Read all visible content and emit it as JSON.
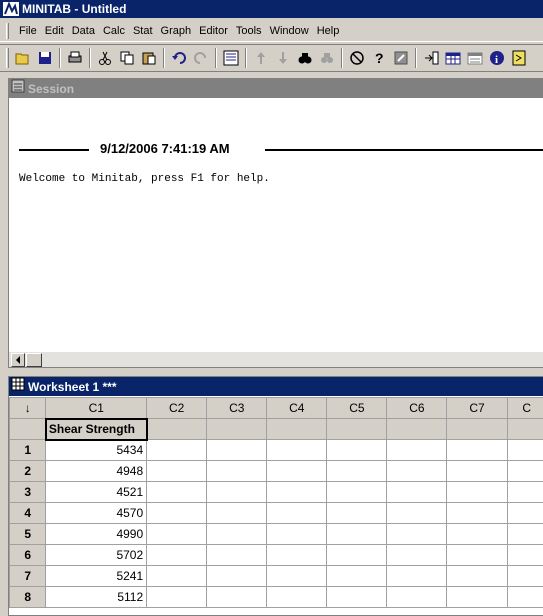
{
  "window": {
    "title": "MINITAB - Untitled"
  },
  "menu": [
    "File",
    "Edit",
    "Data",
    "Calc",
    "Stat",
    "Graph",
    "Editor",
    "Tools",
    "Window",
    "Help"
  ],
  "toolbar": {
    "icons": [
      "open-icon",
      "save-icon",
      "print-icon",
      "cut-icon",
      "copy-icon",
      "paste-icon",
      "undo-icon",
      "redo-icon",
      "worksheet-view-icon",
      "up-arrow-icon",
      "down-arrow-icon",
      "find-icon",
      "replace-icon",
      "cancel-icon",
      "help-icon",
      "assistant-icon",
      "session-icon",
      "data-window-icon",
      "history-icon",
      "info-icon",
      "report-icon"
    ]
  },
  "session": {
    "title": "Session",
    "timestamp": "9/12/2006 7:41:19 AM",
    "welcome": "Welcome to Minitab, press F1 for help."
  },
  "worksheet": {
    "title": "Worksheet 1 ***",
    "corner": "↓",
    "columns": [
      "C1",
      "C2",
      "C3",
      "C4",
      "C5",
      "C6",
      "C7",
      "C"
    ],
    "column_names": [
      "Shear Strength",
      "",
      "",
      "",
      "",
      "",
      "",
      ""
    ],
    "rows": [
      {
        "num": "1",
        "c1": "5434"
      },
      {
        "num": "2",
        "c1": "4948"
      },
      {
        "num": "3",
        "c1": "4521"
      },
      {
        "num": "4",
        "c1": "4570"
      },
      {
        "num": "5",
        "c1": "4990"
      },
      {
        "num": "6",
        "c1": "5702"
      },
      {
        "num": "7",
        "c1": "5241"
      },
      {
        "num": "8",
        "c1": "5112"
      }
    ]
  }
}
